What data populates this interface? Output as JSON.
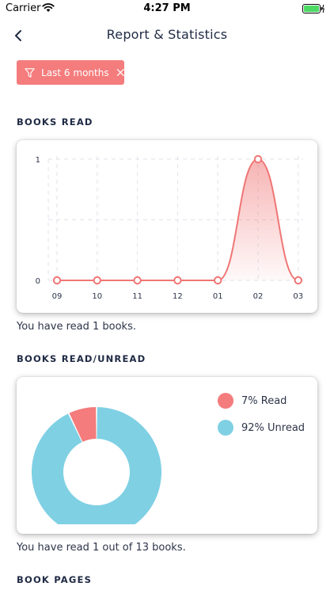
{
  "status_bar": {
    "carrier": "Carrier",
    "time": "4:27 PM"
  },
  "nav": {
    "title": "Report & Statistics"
  },
  "filter": {
    "label": "Last 6 months"
  },
  "sections": {
    "books_read": {
      "heading": "BOOKS READ",
      "summary": "You have read 1 books.",
      "chart_data": {
        "type": "line",
        "x": [
          "09",
          "10",
          "11",
          "12",
          "01",
          "02",
          "03"
        ],
        "series": [
          {
            "values": [
              0,
              0,
              0,
              0,
              0,
              1,
              0
            ]
          }
        ],
        "y_ticks": [
          "0",
          "1"
        ],
        "ylim": [
          0,
          1
        ],
        "grid": true,
        "color": "#f07575"
      }
    },
    "books_read_unread": {
      "heading": "BOOKS READ/UNREAD",
      "summary": "You have read 1 out of 13 books.",
      "legend": {
        "read": "7% Read",
        "unread": "92% Unread"
      },
      "chart_data": {
        "type": "pie",
        "categories": [
          "Read",
          "Unread"
        ],
        "values": [
          7,
          92
        ],
        "colors": [
          "#f47c7c",
          "#7fd0e3"
        ]
      }
    },
    "book_pages": {
      "heading": "BOOK PAGES"
    }
  }
}
